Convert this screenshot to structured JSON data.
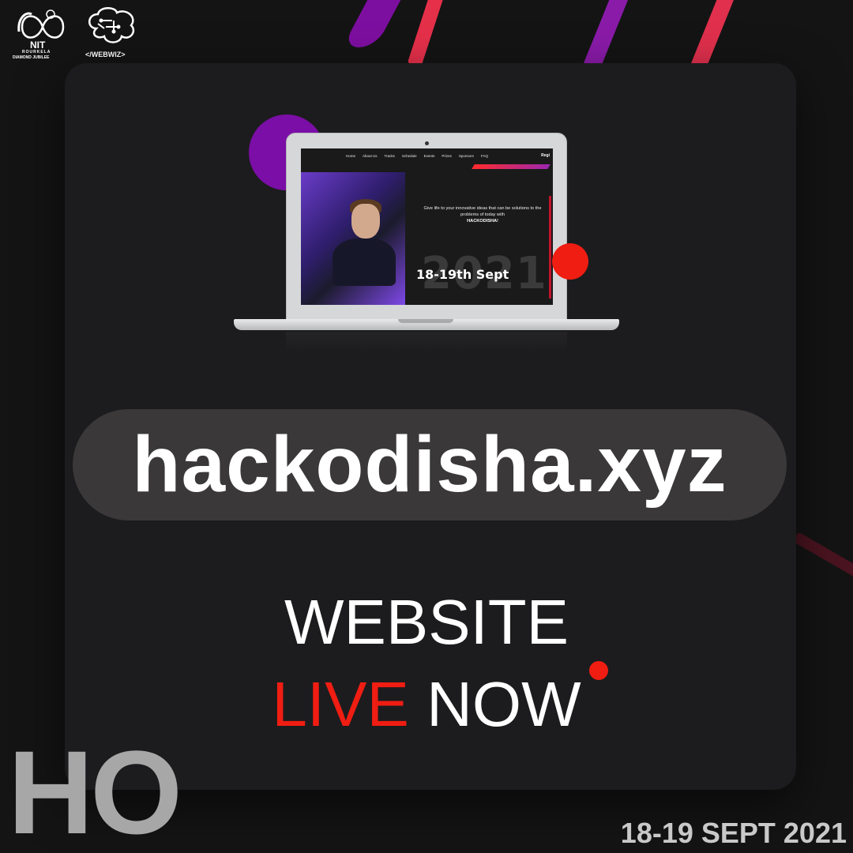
{
  "logos": {
    "nit_text": "NIT",
    "nit_sub": "ROURKELA",
    "nit_sub2": "DIAMOND JUBILEE",
    "webwiz_text": "</WEBWIZ>"
  },
  "laptop_screen": {
    "nav_items": [
      "Home",
      "About Us",
      "Tracks",
      "Schedule",
      "Events",
      "Prizes",
      "Sponsors",
      "FAQ"
    ],
    "nav_register": "Regi",
    "tagline": "Give life to your innovative ideas that can be solutions to the problems of today with",
    "tagline_brand": "HACKODISHA!",
    "year": "2021",
    "date": "18-19th Sept"
  },
  "url": "hackodisha.xyz",
  "headline": {
    "line1": "WEBSITE",
    "live": "LIVE",
    "now": "NOW"
  },
  "corner_letters": "HO",
  "footer_date": "18-19 SEPT 2021",
  "colors": {
    "accent_red": "#f01d12",
    "accent_purple": "#7b0ea6",
    "panel": "#1c1c1e",
    "background": "#141414"
  }
}
